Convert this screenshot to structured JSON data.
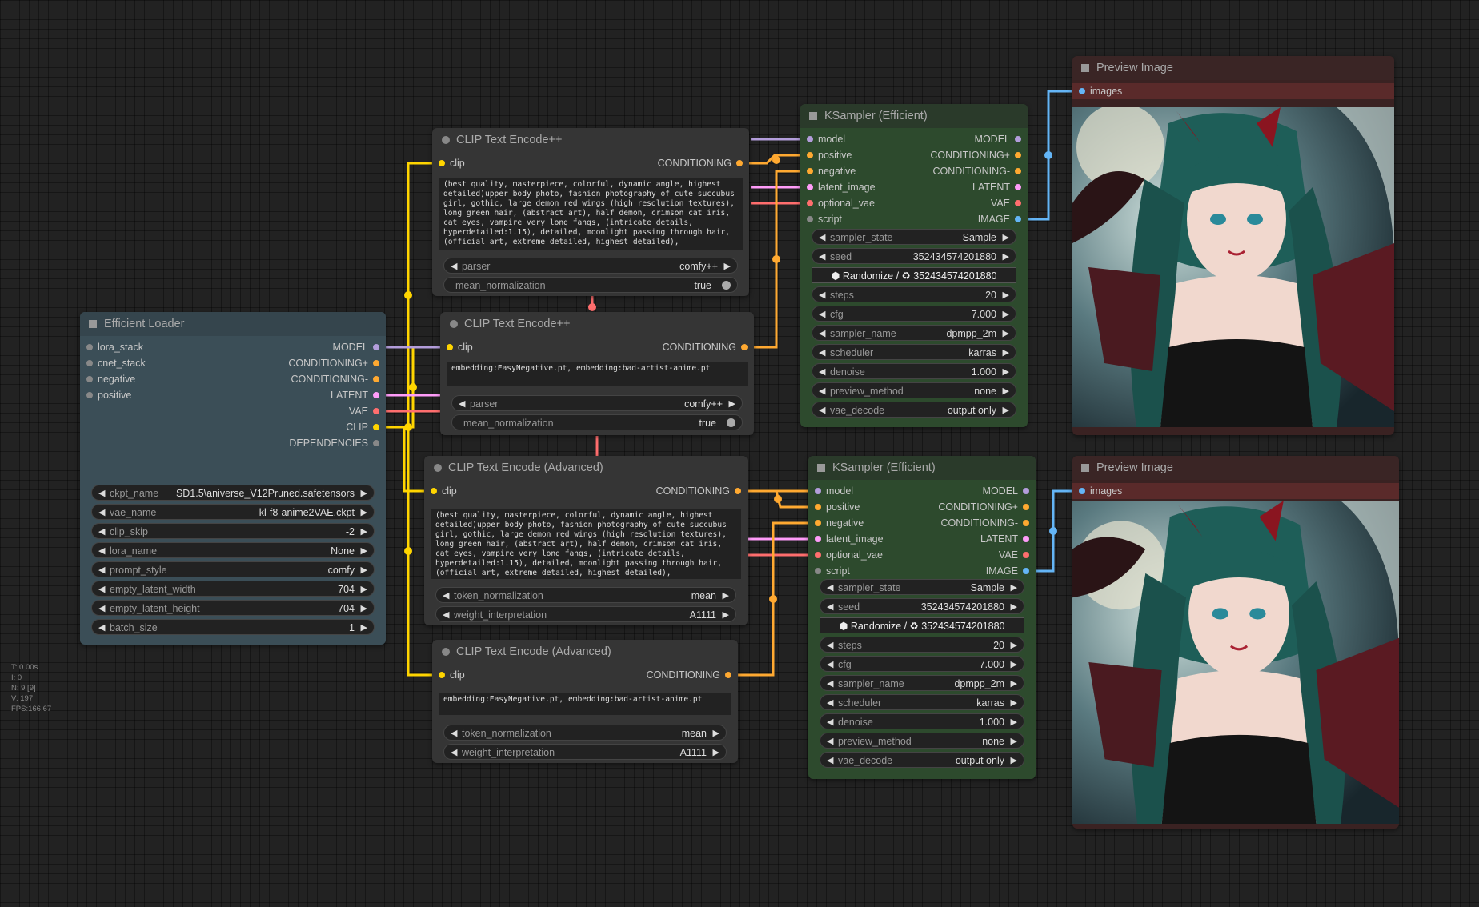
{
  "colors": {
    "model": "#b39ddb",
    "clip": "#ffd500",
    "conditioning": "#ffa931",
    "latent": "#ff9cf9",
    "vae": "#ff6e6e",
    "image": "#64b5f6"
  },
  "stats": [
    "T: 0.00s",
    "I: 0",
    "N: 9 [9]",
    "V: 197",
    "FPS:166.67"
  ],
  "loader": {
    "title": "Efficient Loader",
    "inputs": [
      "lora_stack",
      "cnet_stack",
      "negative",
      "positive"
    ],
    "outputs": [
      "MODEL",
      "CONDITIONING+",
      "CONDITIONING-",
      "LATENT",
      "VAE",
      "CLIP",
      "DEPENDENCIES"
    ],
    "widgets": [
      {
        "label": "ckpt_name",
        "value": "SD1.5\\aniverse_V12Pruned.safetensors"
      },
      {
        "label": "vae_name",
        "value": "kl-f8-anime2VAE.ckpt"
      },
      {
        "label": "clip_skip",
        "value": "-2"
      },
      {
        "label": "lora_name",
        "value": "None"
      },
      {
        "label": "prompt_style",
        "value": "comfy"
      },
      {
        "label": "empty_latent_width",
        "value": "704"
      },
      {
        "label": "empty_latent_height",
        "value": "704"
      },
      {
        "label": "batch_size",
        "value": "1"
      }
    ]
  },
  "clip1": {
    "title": "CLIP Text Encode++",
    "input": "clip",
    "output": "CONDITIONING",
    "text": "(best quality, masterpiece, colorful, dynamic angle, highest detailed)upper body photo, fashion photography of cute succubus girl, gothic, large demon red wings (high resolution textures), long green hair, (abstract art), half demon, crimson cat iris, cat eyes, vampire very long fangs, (intricate details, hyperdetailed:1.15), detailed, moonlight passing through hair, (official art, extreme detailed, highest detailed),",
    "parser_label": "parser",
    "parser_value": "comfy++",
    "mean_label": "mean_normalization",
    "mean_value": "true"
  },
  "clip2": {
    "title": "CLIP Text Encode++",
    "input": "clip",
    "output": "CONDITIONING",
    "text": "embedding:EasyNegative.pt, embedding:bad-artist-anime.pt",
    "parser_label": "parser",
    "parser_value": "comfy++",
    "mean_label": "mean_normalization",
    "mean_value": "true"
  },
  "clip3": {
    "title": "CLIP Text Encode (Advanced)",
    "input": "clip",
    "output": "CONDITIONING",
    "text": "(best quality, masterpiece, colorful, dynamic angle, highest detailed)upper body photo, fashion photography of cute succubus girl, gothic, large demon red wings (high resolution textures), long green hair, (abstract art), half demon, crimson cat iris, cat eyes, vampire very long fangs, (intricate details, hyperdetailed:1.15), detailed, moonlight passing through hair, (official art, extreme detailed, highest detailed),",
    "token_label": "token_normalization",
    "token_value": "mean",
    "weight_label": "weight_interpretation",
    "weight_value": "A1111"
  },
  "clip4": {
    "title": "CLIP Text Encode (Advanced)",
    "input": "clip",
    "output": "CONDITIONING",
    "text": "embedding:EasyNegative.pt, embedding:bad-artist-anime.pt",
    "token_label": "token_normalization",
    "token_value": "mean",
    "weight_label": "weight_interpretation",
    "weight_value": "A1111"
  },
  "ks1": {
    "title": "KSampler (Efficient)",
    "inputs": [
      "model",
      "positive",
      "negative",
      "latent_image",
      "optional_vae",
      "script"
    ],
    "outputs": [
      "MODEL",
      "CONDITIONING+",
      "CONDITIONING-",
      "LATENT",
      "VAE",
      "IMAGE"
    ],
    "widgets": [
      {
        "label": "sampler_state",
        "value": "Sample"
      },
      {
        "label": "seed",
        "value": "352434574201880"
      },
      {
        "label": "steps",
        "value": "20"
      },
      {
        "label": "cfg",
        "value": "7.000"
      },
      {
        "label": "sampler_name",
        "value": "dpmpp_2m"
      },
      {
        "label": "scheduler",
        "value": "karras"
      },
      {
        "label": "denoise",
        "value": "1.000"
      },
      {
        "label": "preview_method",
        "value": "none"
      },
      {
        "label": "vae_decode",
        "value": "output only"
      }
    ],
    "randomize": "Randomize / ♻ 352434574201880"
  },
  "ks2": {
    "title": "KSampler (Efficient)",
    "inputs": [
      "model",
      "positive",
      "negative",
      "latent_image",
      "optional_vae",
      "script"
    ],
    "outputs": [
      "MODEL",
      "CONDITIONING+",
      "CONDITIONING-",
      "LATENT",
      "VAE",
      "IMAGE"
    ],
    "widgets": [
      {
        "label": "sampler_state",
        "value": "Sample"
      },
      {
        "label": "seed",
        "value": "352434574201880"
      },
      {
        "label": "steps",
        "value": "20"
      },
      {
        "label": "cfg",
        "value": "7.000"
      },
      {
        "label": "sampler_name",
        "value": "dpmpp_2m"
      },
      {
        "label": "scheduler",
        "value": "karras"
      },
      {
        "label": "denoise",
        "value": "1.000"
      },
      {
        "label": "preview_method",
        "value": "none"
      },
      {
        "label": "vae_decode",
        "value": "output only"
      }
    ],
    "randomize": "Randomize / ♻ 352434574201880"
  },
  "prev1": {
    "title": "Preview Image",
    "input": "images"
  },
  "prev2": {
    "title": "Preview Image",
    "input": "images"
  }
}
